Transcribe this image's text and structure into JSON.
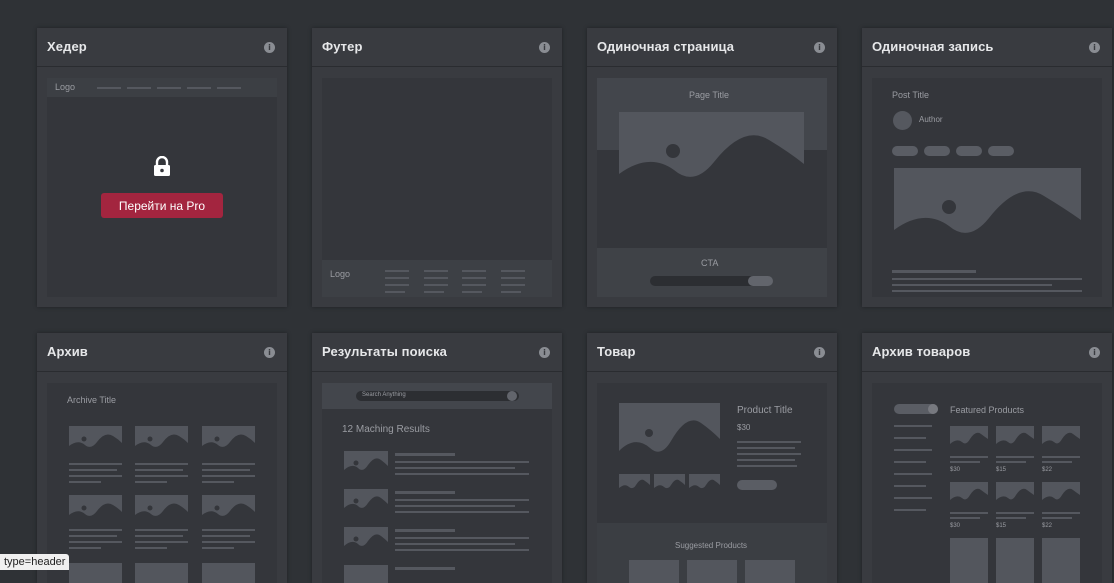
{
  "cards": [
    {
      "title": "Хедер",
      "preview": {
        "logo": "Logo",
        "cta_button": "Перейти на Pro"
      }
    },
    {
      "title": "Футер",
      "preview": {
        "logo": "Logo"
      }
    },
    {
      "title": "Одиночная страница",
      "preview": {
        "page_title": "Page Title",
        "cta": "CTA"
      }
    },
    {
      "title": "Одиночная запись",
      "preview": {
        "post_title": "Post Title",
        "author": "Author"
      }
    },
    {
      "title": "Архив",
      "preview": {
        "archive_title": "Archive Title"
      }
    },
    {
      "title": "Результаты поиска",
      "preview": {
        "search_placeholder": "Search Anything",
        "results_count": "12 Maching Results"
      }
    },
    {
      "title": "Товар",
      "preview": {
        "product_title": "Product Title",
        "price": "$30",
        "suggested": "Suggested Products"
      }
    },
    {
      "title": "Архив товаров",
      "preview": {
        "featured": "Featured Products",
        "prices": [
          "$30",
          "$15",
          "$22"
        ]
      }
    }
  ],
  "tooltip": "type=header",
  "colors": {
    "accent": "#a3253f",
    "background": "#2f3236",
    "card": "#393b40"
  },
  "icons": {
    "info": "info-icon",
    "lock": "lock-icon",
    "search": "search-icon"
  }
}
